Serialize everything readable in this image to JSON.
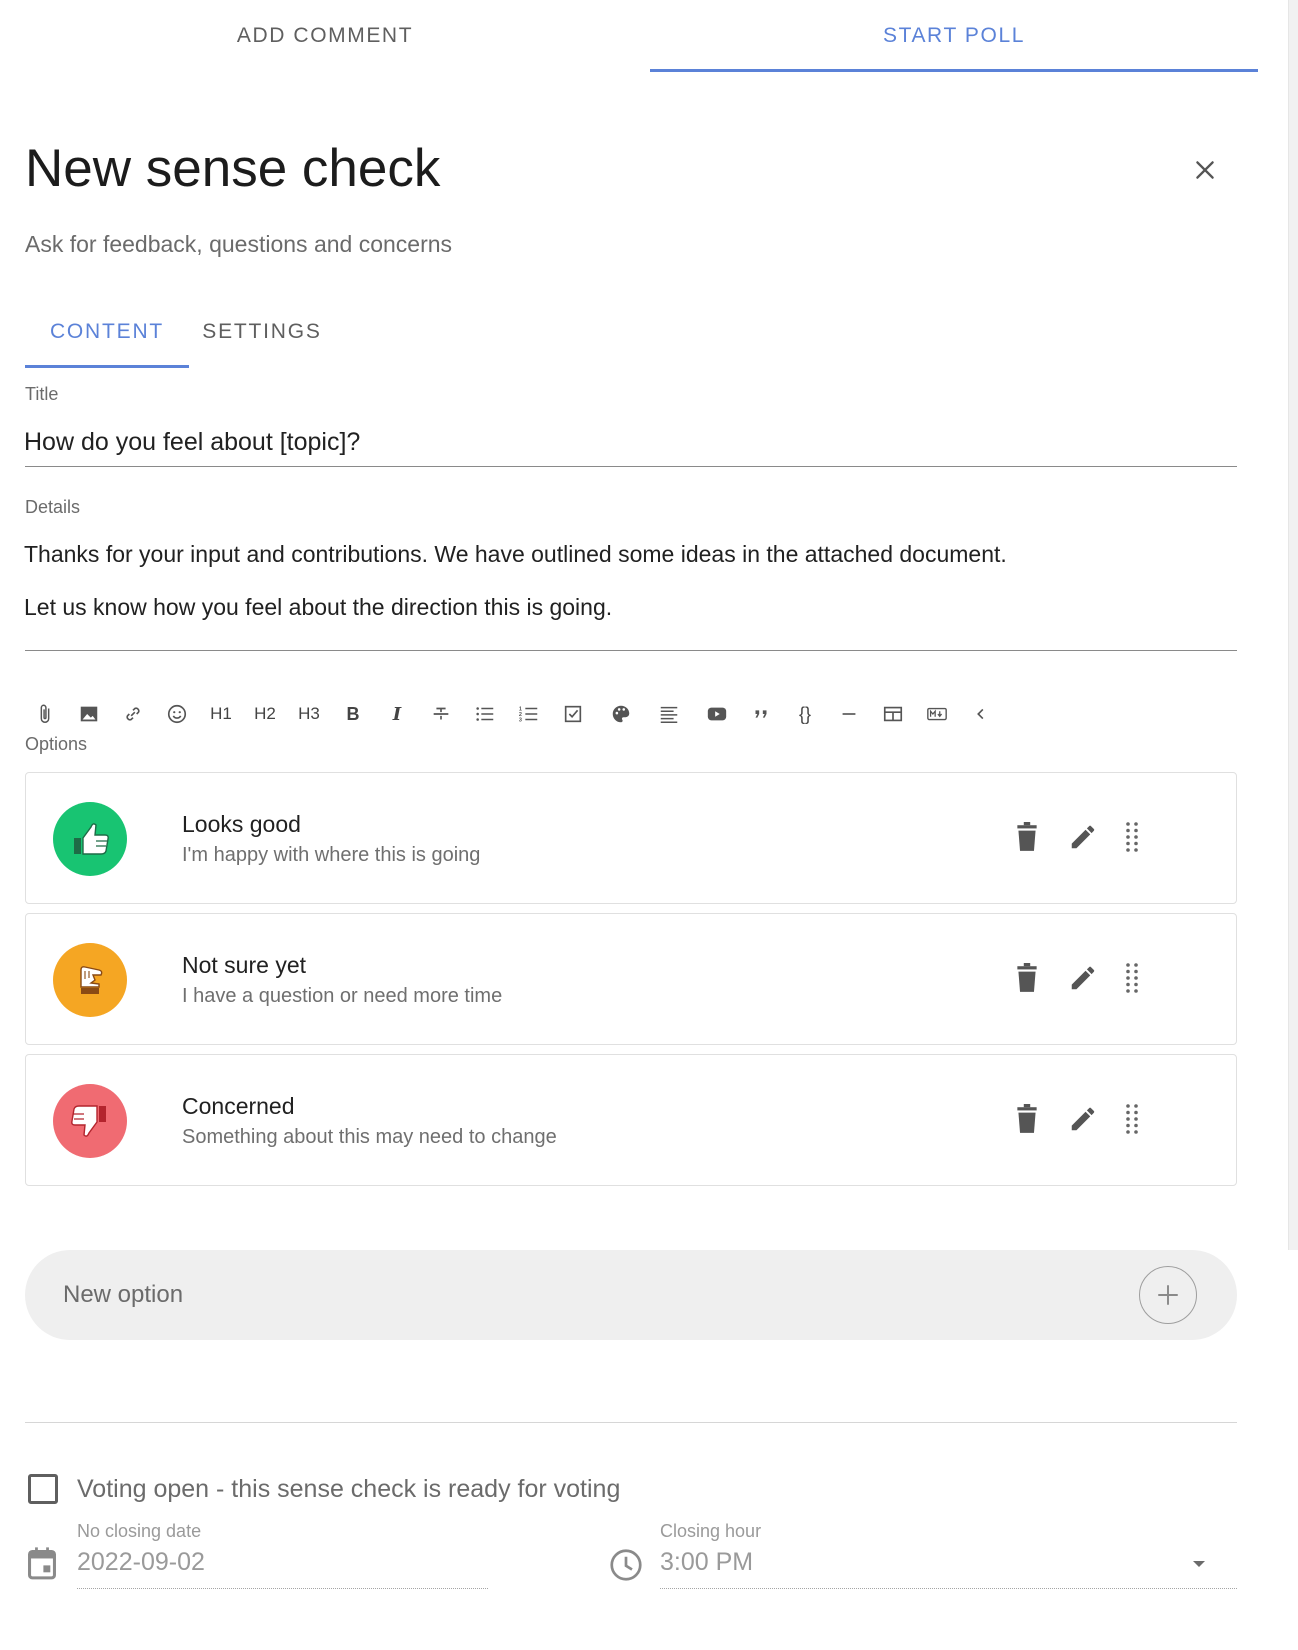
{
  "top_tabs": {
    "add_comment": "ADD COMMENT",
    "start_poll": "START POLL"
  },
  "form": {
    "title": "New sense check",
    "subtitle": "Ask for feedback, questions and concerns"
  },
  "inner_tabs": {
    "content": "CONTENT",
    "settings": "SETTINGS"
  },
  "title_field": {
    "label": "Title",
    "value": "How do you feel about [topic]?"
  },
  "details_field": {
    "label": "Details",
    "paragraphs": [
      "Thanks for your input and contributions. We have outlined some ideas in the attached document.",
      "Let us know how you feel about the direction this is going."
    ]
  },
  "toolbar": {
    "items": [
      "paperclip-icon",
      "image-icon",
      "link-icon",
      "emoji-icon",
      "H1",
      "H2",
      "H3",
      "B",
      "I",
      "strikethrough-icon",
      "bullet-list-icon",
      "numbered-list-icon",
      "checklist-icon",
      "palette-icon",
      "align-icon",
      "youtube-icon",
      "quote-icon",
      "{}",
      "horizontal-rule-icon",
      "table-icon",
      "markdown-icon",
      "chevron-left-icon"
    ]
  },
  "options": {
    "label": "Options",
    "items": [
      {
        "name": "Looks good",
        "description": "I'm happy with where this is going",
        "icon": "thumbs-up-icon",
        "color": "#18c472"
      },
      {
        "name": "Not sure yet",
        "description": "I have a question or need more time",
        "icon": "thumbs-sideways-icon",
        "color": "#f5a623"
      },
      {
        "name": "Concerned",
        "description": "Something about this may need to change",
        "icon": "thumbs-down-icon",
        "color": "#f06b72"
      }
    ]
  },
  "new_option": {
    "placeholder": "New option"
  },
  "voting": {
    "label": "Voting open - this sense check is ready for voting"
  },
  "closing_date": {
    "label": "No closing date",
    "value": "2022-09-02"
  },
  "closing_hour": {
    "label": "Closing hour",
    "value": "3:00 PM"
  },
  "colors": {
    "accent": "#5b82d8",
    "text": "#212121",
    "muted": "#6b6b6b"
  }
}
